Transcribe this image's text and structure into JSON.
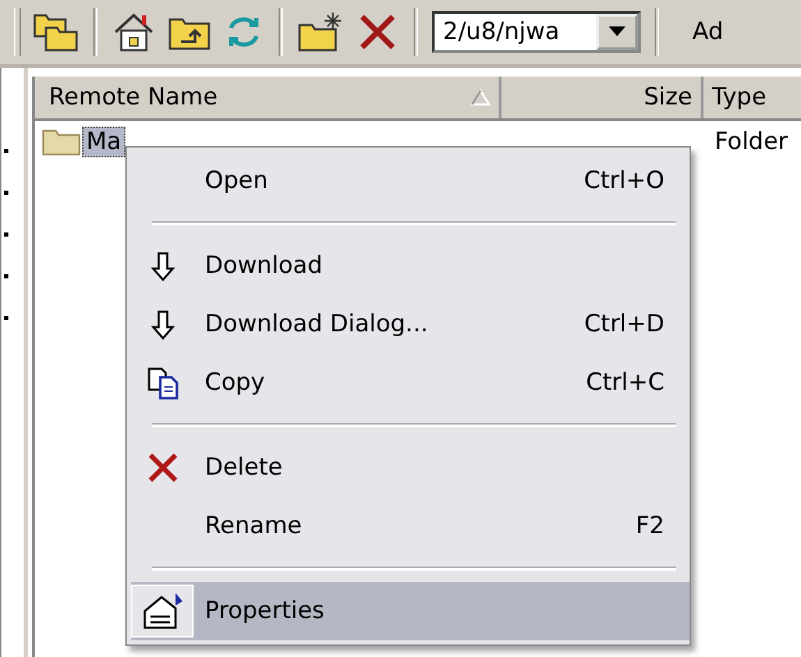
{
  "toolbar": {
    "path_field": {
      "value": "2/u8/njwa"
    },
    "add_button": {
      "label": "Ad"
    }
  },
  "file_list": {
    "columns": [
      {
        "label": "Remote Name",
        "sorted": true
      },
      {
        "label": "Size",
        "sorted": false
      },
      {
        "label": "Type",
        "sorted": false
      }
    ],
    "rows": [
      {
        "name": "Ma",
        "type": "Folder",
        "selected": true
      }
    ]
  },
  "context_menu": {
    "items": [
      {
        "kind": "item",
        "label": "Open",
        "shortcut": "Ctrl+O",
        "selected": false
      },
      {
        "kind": "separator"
      },
      {
        "kind": "item",
        "label": "Download",
        "selected": false
      },
      {
        "kind": "item",
        "label": "Download Dialog...",
        "shortcut": "Ctrl+D",
        "selected": false
      },
      {
        "kind": "item",
        "label": "Copy",
        "shortcut": "Ctrl+C",
        "selected": false
      },
      {
        "kind": "separator"
      },
      {
        "kind": "item",
        "label": "Delete",
        "selected": false
      },
      {
        "kind": "item",
        "label": "Rename",
        "shortcut": "F2",
        "selected": false
      },
      {
        "kind": "separator"
      },
      {
        "kind": "item",
        "label": "Properties",
        "selected": true
      }
    ]
  }
}
